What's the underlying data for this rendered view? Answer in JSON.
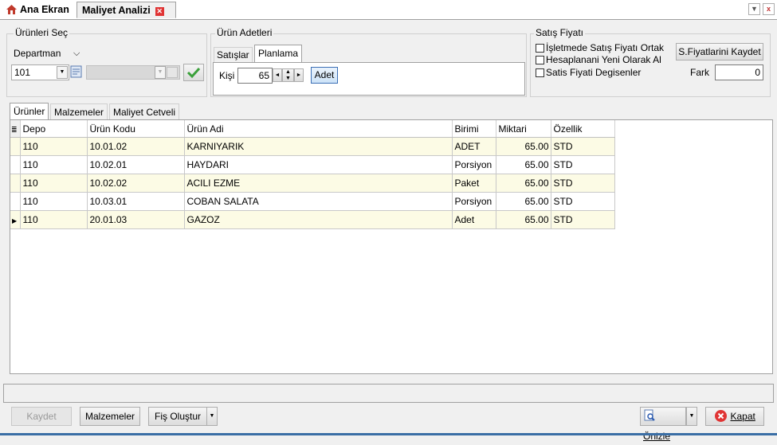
{
  "tabs": {
    "home": "Ana Ekran",
    "active": "Maliyet Analizi"
  },
  "urunleri_sec": {
    "title": "Ürünleri Seç",
    "type": "Departman",
    "code": "101"
  },
  "urun_adetleri": {
    "title": "Ürün Adetleri",
    "tab1": "Satışlar",
    "tab2": "Planlama",
    "kisi_label": "Kişi",
    "kisi_value": "65",
    "adet_button": "Adet"
  },
  "satis_fiyati": {
    "title": "Satış Fiyatı",
    "opt1": "İşletmede Satış Fiyatı Ortak",
    "opt2": "Hesaplanani Yeni Olarak Al",
    "opt3": "Satis Fiyati Degisenler",
    "save_button": "S.Fiyatlarini Kaydet",
    "fark_label": "Fark",
    "fark_value": "0"
  },
  "subtabs": [
    "Ürünler",
    "Malzemeler",
    "Maliyet Cetveli"
  ],
  "grid": {
    "columns": [
      "Depo",
      "Ürün Kodu",
      "Ürün Adi",
      "Birimi",
      "Miktari",
      "Özellik"
    ],
    "rows": [
      [
        "110",
        "10.01.02",
        "KARNIYARIK",
        "ADET",
        "65.00",
        "STD"
      ],
      [
        "110",
        "10.02.01",
        "HAYDARI",
        "Porsiyon",
        "65.00",
        "STD"
      ],
      [
        "110",
        "10.02.02",
        "ACILI EZME",
        "Paket",
        "65.00",
        "STD"
      ],
      [
        "110",
        "10.03.01",
        "COBAN SALATA",
        "Porsiyon",
        "65.00",
        "STD"
      ],
      [
        "110",
        "20.01.03",
        "GAZOZ",
        "Adet",
        "65.00",
        "STD"
      ]
    ]
  },
  "buttons": {
    "kaydet": "Kaydet",
    "malzemeler": "Malzemeler",
    "fis": "Fiş Oluştur",
    "onizle": "Önizle",
    "kapat": "Kapat"
  },
  "colors": {
    "odd_row": "#fcfbe5",
    "accent": "#3a6ea5",
    "close_red": "#e03434",
    "check_green": "#3aa03a"
  }
}
